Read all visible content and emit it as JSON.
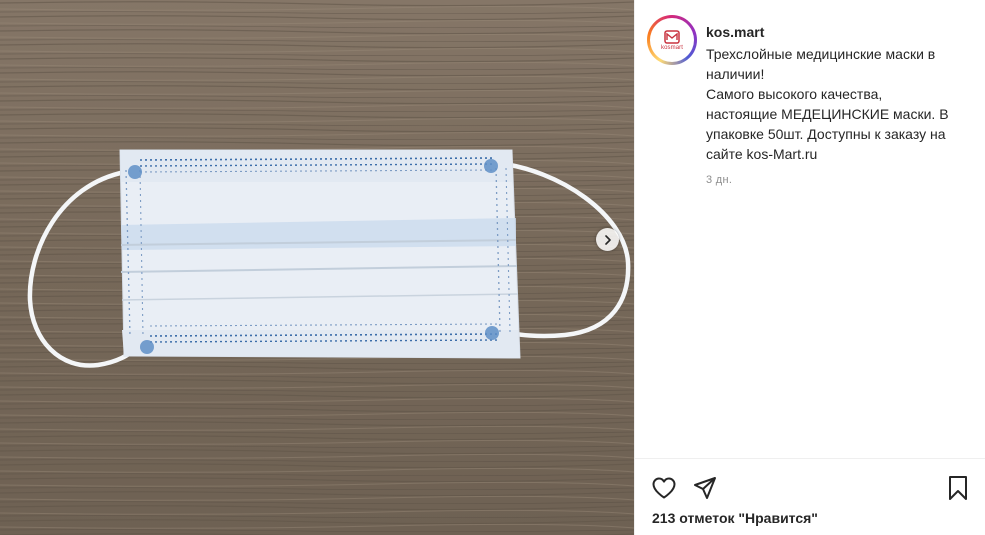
{
  "post": {
    "username": "kos.mart",
    "avatar_brand": "kosmart",
    "caption": "Трехслойные медицинские маски в\nналичии!\nСамого высокого качества,\nнастоящие МЕДЕЦИНСКИЕ маски. В\nупаковке 50шт. Доступны к заказу на\nсайте kos-Mart.ru",
    "timestamp": "3 дн.",
    "likes": "213 отметок \"Нравится\""
  },
  "icons": {
    "next": "chevron-right-icon",
    "like": "heart-icon",
    "share": "paper-plane-icon",
    "save": "bookmark-icon"
  },
  "colors": {
    "text": "#262626",
    "secondary": "#8e8e8e",
    "brand_red": "#c8323f"
  }
}
